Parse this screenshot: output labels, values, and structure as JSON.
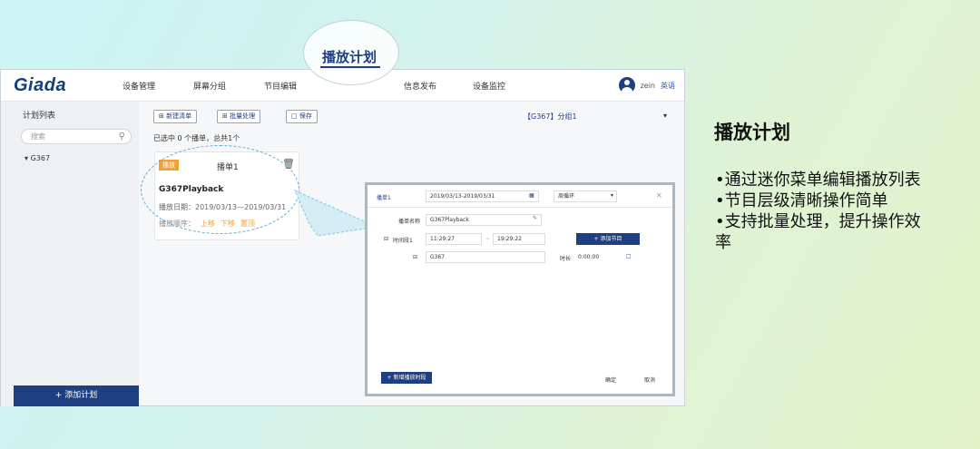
{
  "callout": {
    "title": "播放计划"
  },
  "app": {
    "logo": "Giada",
    "nav": [
      "设备管理",
      "屏幕分组",
      "节目编辑",
      "播放计划",
      "信息发布",
      "设备监控"
    ],
    "user_name": "zein",
    "lang_label": "英语"
  },
  "sidebar": {
    "title": "计划列表",
    "search_placeholder": "搜索",
    "tree_item": "G367",
    "add_button": "+ 添加计划"
  },
  "toolbar": {
    "new_list": "新建清单",
    "batch": "批量处理",
    "save": "保存",
    "group_select": "【G367】分组1",
    "selected_info": "已选中 0 个播单，总共1个"
  },
  "card": {
    "badge": "播放",
    "name": "播单1",
    "title": "G367Playback",
    "date": "播放日期：2019/03/13—2019/03/31",
    "order_label": "播放顺序：",
    "actions": [
      "上移",
      "下移",
      "置顶"
    ]
  },
  "dialog": {
    "tab": "播单1",
    "date_range": "2019/03/13-2019/03/31",
    "mode": "周循环",
    "name_label": "播单名称",
    "name_value": "G367Playback",
    "time_label": "时间段1",
    "time_start": "11:29:27",
    "time_end": "19:29:22",
    "add_program": "+ 添加节目",
    "program": "G367",
    "duration_label": "时长",
    "duration_value": "0:00:00",
    "add_time": "+ 新增播放时段",
    "ok": "确定",
    "cancel": "取消"
  },
  "description": {
    "title": "播放计划",
    "bullets": [
      "•通过迷你菜单编辑播放列表",
      "•节目层级清晰操作简单",
      "•支持批量处理，提升操作效率"
    ]
  }
}
